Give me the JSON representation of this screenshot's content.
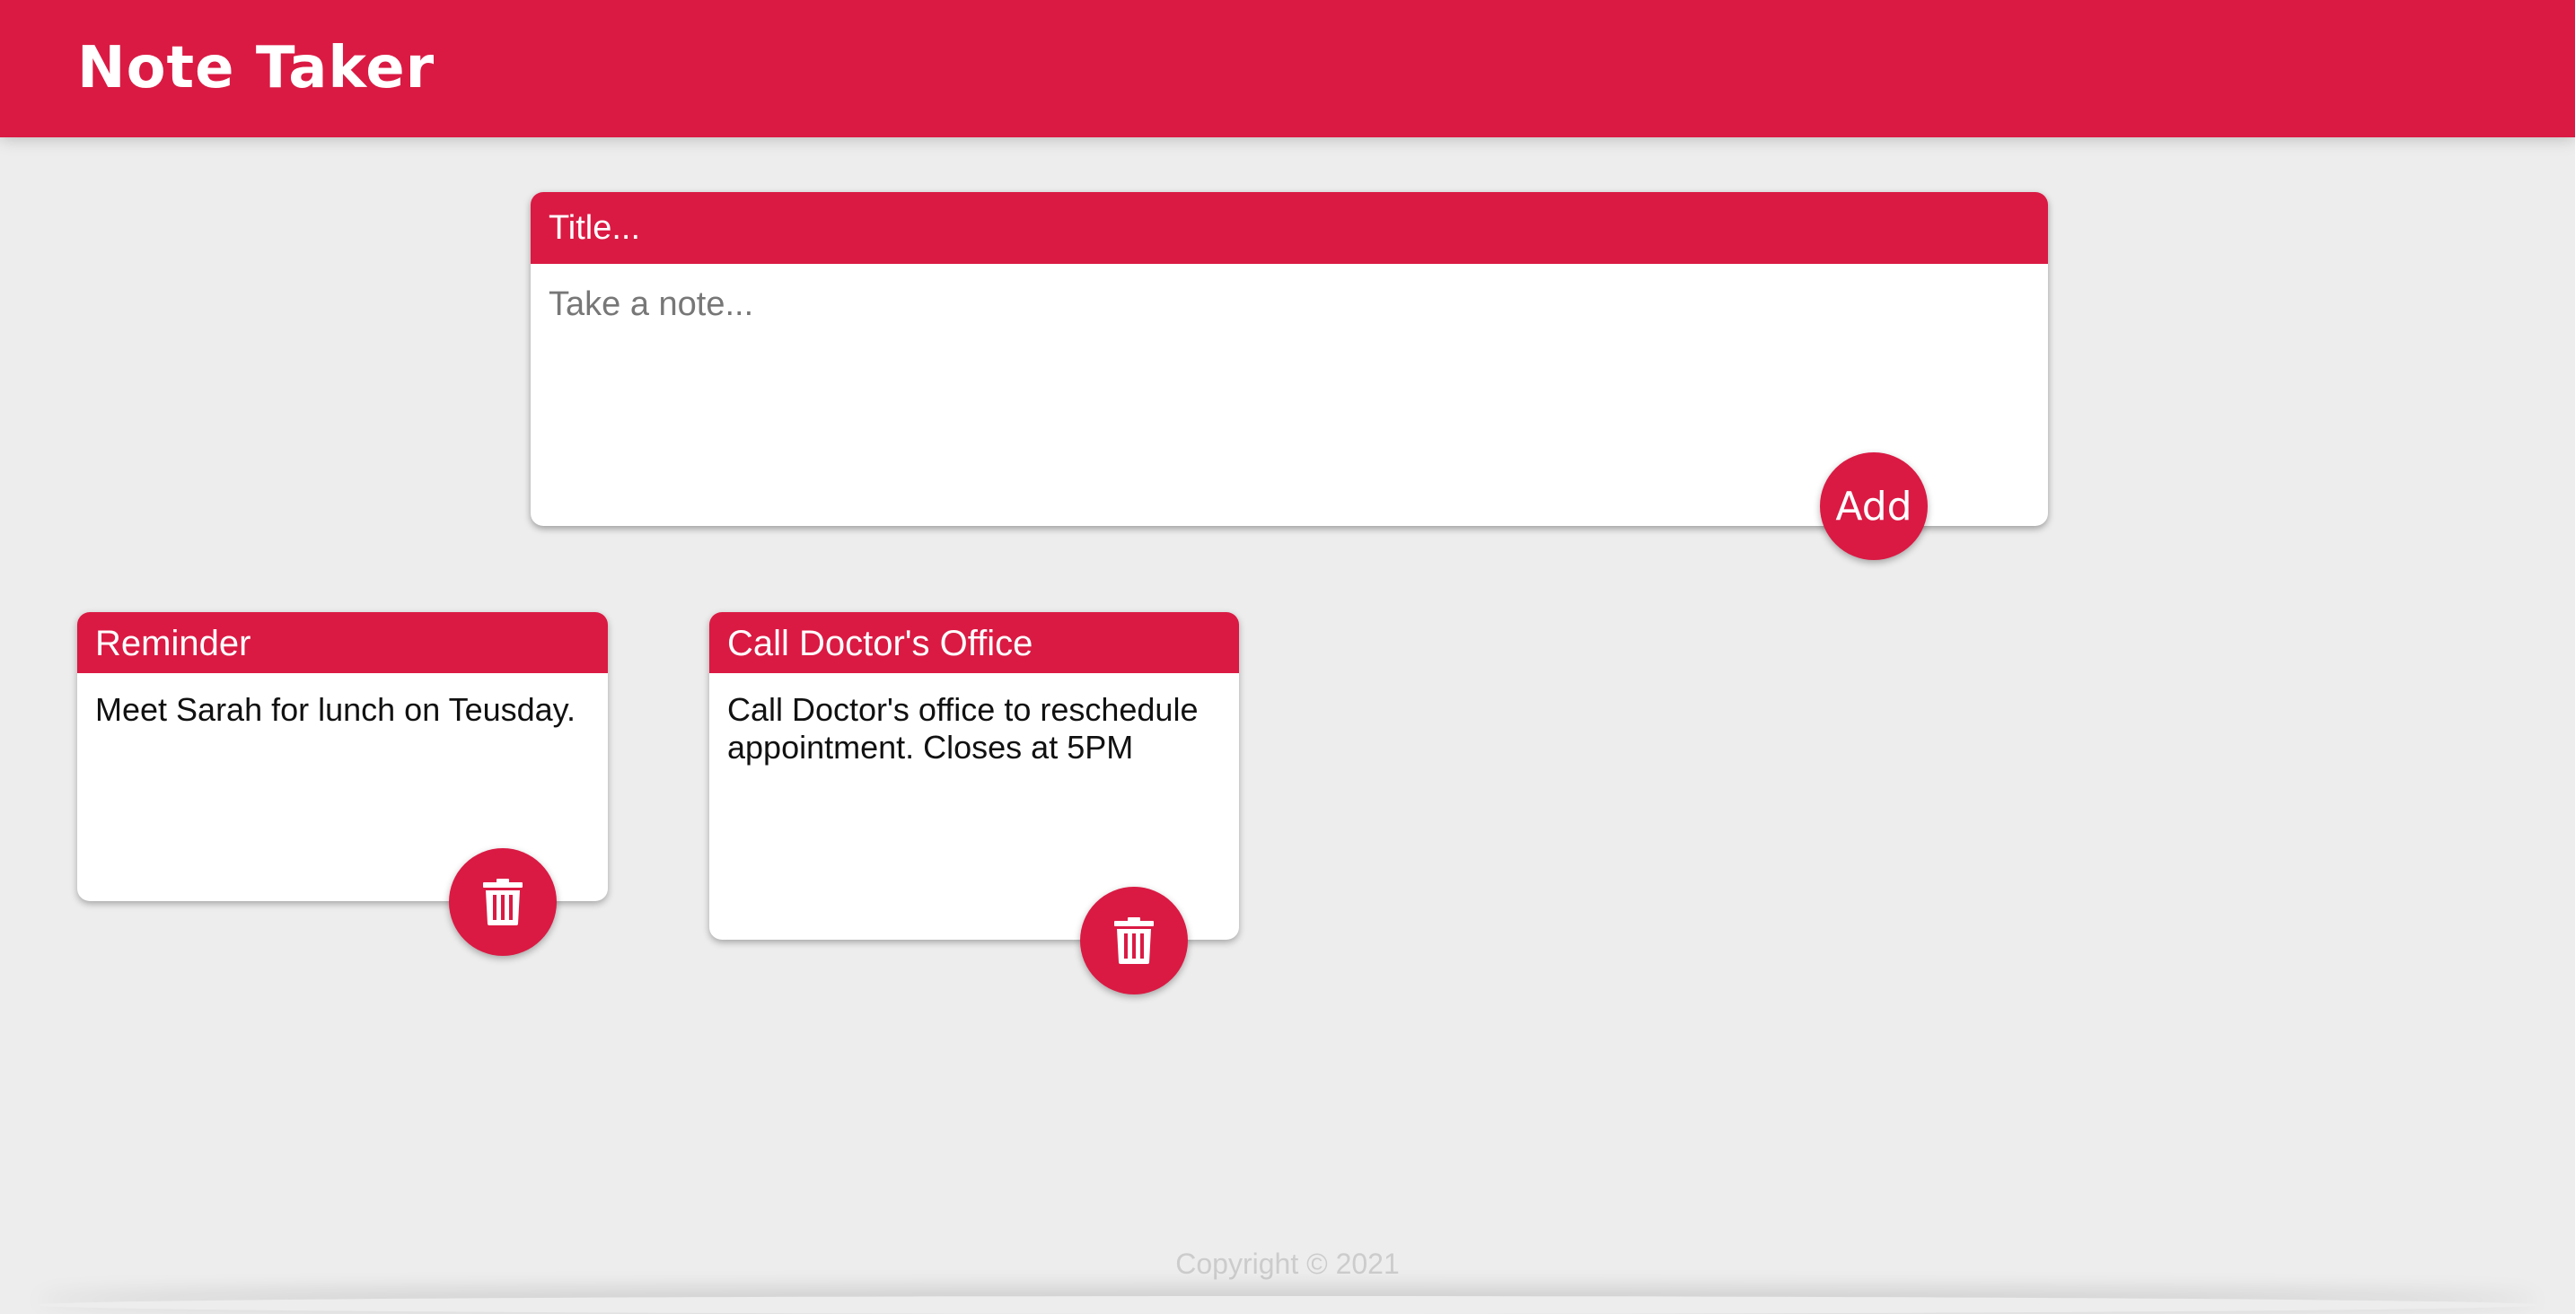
{
  "header": {
    "title": "Note Taker"
  },
  "create_form": {
    "title_placeholder": "Title...",
    "title_value": "",
    "content_placeholder": "Take a note...",
    "content_value": "",
    "add_label": "Add"
  },
  "notes": [
    {
      "title": "Reminder",
      "content": "Meet Sarah for lunch on Teusday.",
      "delete_icon": "trash-icon"
    },
    {
      "title": "Call Doctor's Office",
      "content": "Call Doctor's office to reschedule appointment. Closes at 5PM",
      "delete_icon": "trash-icon"
    }
  ],
  "footer": {
    "copyright": "Copyright © 2021"
  },
  "colors": {
    "accent": "#da1a43",
    "background": "#ededed",
    "card": "#ffffff",
    "footer_text": "#cccccc"
  }
}
